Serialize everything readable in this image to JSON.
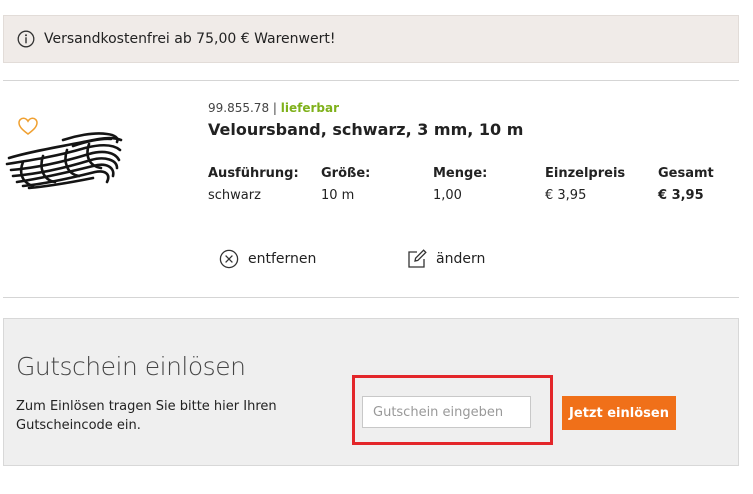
{
  "banner": {
    "text": "Versandkostenfrei ab 75,00 €  Warenwert!",
    "icon": "info-icon"
  },
  "product": {
    "sku": "99.855.78",
    "separator": "|",
    "availability": "lieferbar",
    "title": "Veloursband, schwarz, 3 mm, 10 m",
    "columns": [
      {
        "label": "Ausführung:",
        "value": "schwarz"
      },
      {
        "label": "Größe:",
        "value": "10 m"
      },
      {
        "label": "Menge:",
        "value": "1,00"
      },
      {
        "label": "Einzelpreis",
        "value": "€ 3,95"
      },
      {
        "label": "Gesamt",
        "value": "€ 3,95"
      }
    ],
    "actions": {
      "remove": "entfernen",
      "edit": "ändern"
    }
  },
  "coupon": {
    "title": "Gutschein einlösen",
    "description": "Zum Einlösen tragen Sie bitte hier Ihren Gutscheincode ein.",
    "input_placeholder": "Gutschein eingeben",
    "input_value": "",
    "button_label": "Jetzt einlösen"
  },
  "colors": {
    "accent": "#f07019",
    "available": "#7fb11b",
    "highlight": "#e3262a",
    "wishlist": "#f0a030"
  }
}
